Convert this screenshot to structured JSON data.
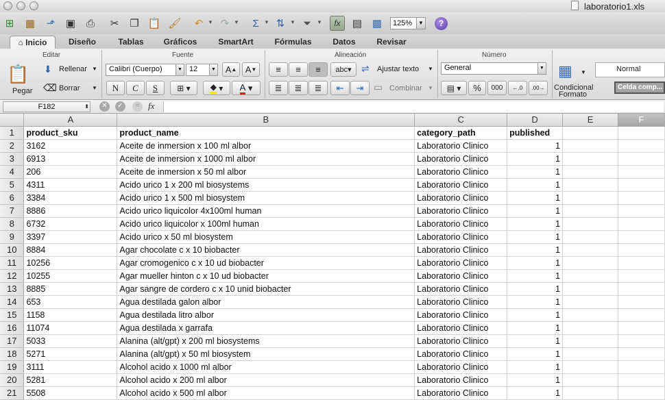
{
  "window": {
    "title": "laboratorio1.xls"
  },
  "toolbar": {
    "zoom": "125%",
    "icons": [
      "new-workbook-icon",
      "templates-icon",
      "open-icon",
      "save-icon",
      "print-icon",
      "cut-icon",
      "copy-icon",
      "paste-icon",
      "format-painter-icon",
      "undo-icon",
      "redo-icon",
      "autosum-icon",
      "sort-icon",
      "filter-icon",
      "function-icon",
      "show-hide-icon",
      "gallery-icon",
      "zoom-select",
      "help-icon"
    ]
  },
  "tabs": [
    "Inicio",
    "Diseño",
    "Tablas",
    "Gráficos",
    "SmartArt",
    "Fórmulas",
    "Datos",
    "Revisar"
  ],
  "ribbon": {
    "editar": {
      "title": "Editar",
      "paste": "Pegar",
      "fill": "Rellenar",
      "clear": "Borrar"
    },
    "fuente": {
      "title": "Fuente",
      "font": "Calibri (Cuerpo)",
      "size": "12",
      "bold": "N",
      "italic": "C",
      "underline": "S"
    },
    "alineacion": {
      "title": "Alineación",
      "wrap": "Ajustar texto",
      "merge": "Combinar",
      "orientation": "abc"
    },
    "numero": {
      "title": "Número",
      "format": "General",
      "percent": "%",
      "thousands": "000"
    },
    "estilos": {
      "conditional": "Condicional",
      "formato": "Formato",
      "normal": "Normal",
      "celda": "Celda comp..."
    }
  },
  "formula_bar": {
    "cell_ref": "F182",
    "fx": "fx",
    "content": ""
  },
  "columns": [
    "A",
    "B",
    "C",
    "D",
    "E",
    "F"
  ],
  "rows": [
    {
      "n": "1",
      "a": "product_sku",
      "b": "product_name",
      "c": "category_path",
      "d": "published"
    },
    {
      "n": "2",
      "a": "3162",
      "b": "Aceite de inmersion x 100 ml albor",
      "c": "Laboratorio Clinico",
      "d": "1"
    },
    {
      "n": "3",
      "a": "6913",
      "b": "Aceite de inmersion x 1000 ml albor",
      "c": "Laboratorio Clinico",
      "d": "1"
    },
    {
      "n": "4",
      "a": "206",
      "b": "Aceite de inmersion x 50 ml albor",
      "c": "Laboratorio Clinico",
      "d": "1"
    },
    {
      "n": "5",
      "a": "4311",
      "b": "Acido urico 1 x 200 ml biosystems",
      "c": "Laboratorio Clinico",
      "d": "1"
    },
    {
      "n": "6",
      "a": "3384",
      "b": "Acido urico 1 x 500 ml biosystem",
      "c": "Laboratorio Clinico",
      "d": "1"
    },
    {
      "n": "7",
      "a": "8886",
      "b": "Acido urico liquicolor  4x100ml human",
      "c": "Laboratorio Clinico",
      "d": "1"
    },
    {
      "n": "8",
      "a": "6732",
      "b": "Acido urico liquicolor x 100ml human",
      "c": "Laboratorio Clinico",
      "d": "1"
    },
    {
      "n": "9",
      "a": "3397",
      "b": "Acido urico x 50 ml biosystem",
      "c": "Laboratorio Clinico",
      "d": "1"
    },
    {
      "n": "10",
      "a": "8884",
      "b": "Agar chocolate c x 10 biobacter",
      "c": "Laboratorio Clinico",
      "d": "1"
    },
    {
      "n": "11",
      "a": "10256",
      "b": "Agar cromogenico c x 10 ud biobacter",
      "c": "Laboratorio Clinico",
      "d": "1"
    },
    {
      "n": "12",
      "a": "10255",
      "b": "Agar mueller hinton c x 10 ud biobacter",
      "c": "Laboratorio Clinico",
      "d": "1"
    },
    {
      "n": "13",
      "a": "8885",
      "b": "Agar sangre de cordero c x 10 unid biobacter",
      "c": "Laboratorio Clinico",
      "d": "1"
    },
    {
      "n": "14",
      "a": "653",
      "b": "Agua destilada galon albor",
      "c": "Laboratorio Clinico",
      "d": "1"
    },
    {
      "n": "15",
      "a": "1158",
      "b": "Agua destilada litro albor",
      "c": "Laboratorio Clinico",
      "d": "1"
    },
    {
      "n": "16",
      "a": "11074",
      "b": "Agua destilada x garrafa",
      "c": "Laboratorio Clinico",
      "d": "1"
    },
    {
      "n": "17",
      "a": "5033",
      "b": "Alanina (alt/gpt) x 200 ml biosystems",
      "c": "Laboratorio Clinico",
      "d": "1"
    },
    {
      "n": "18",
      "a": "5271",
      "b": "Alanina (alt/gpt) x 50 ml biosystem",
      "c": "Laboratorio Clinico",
      "d": "1"
    },
    {
      "n": "19",
      "a": "3111",
      "b": "Alcohol acido x 1000 ml albor",
      "c": "Laboratorio Clinico",
      "d": "1"
    },
    {
      "n": "20",
      "a": "5281",
      "b": "Alcohol acido x 200 ml albor",
      "c": "Laboratorio Clinico",
      "d": "1"
    },
    {
      "n": "21",
      "a": "5508",
      "b": "Alcohol acido x 500 ml albor",
      "c": "Laboratorio Clinico",
      "d": "1"
    }
  ]
}
